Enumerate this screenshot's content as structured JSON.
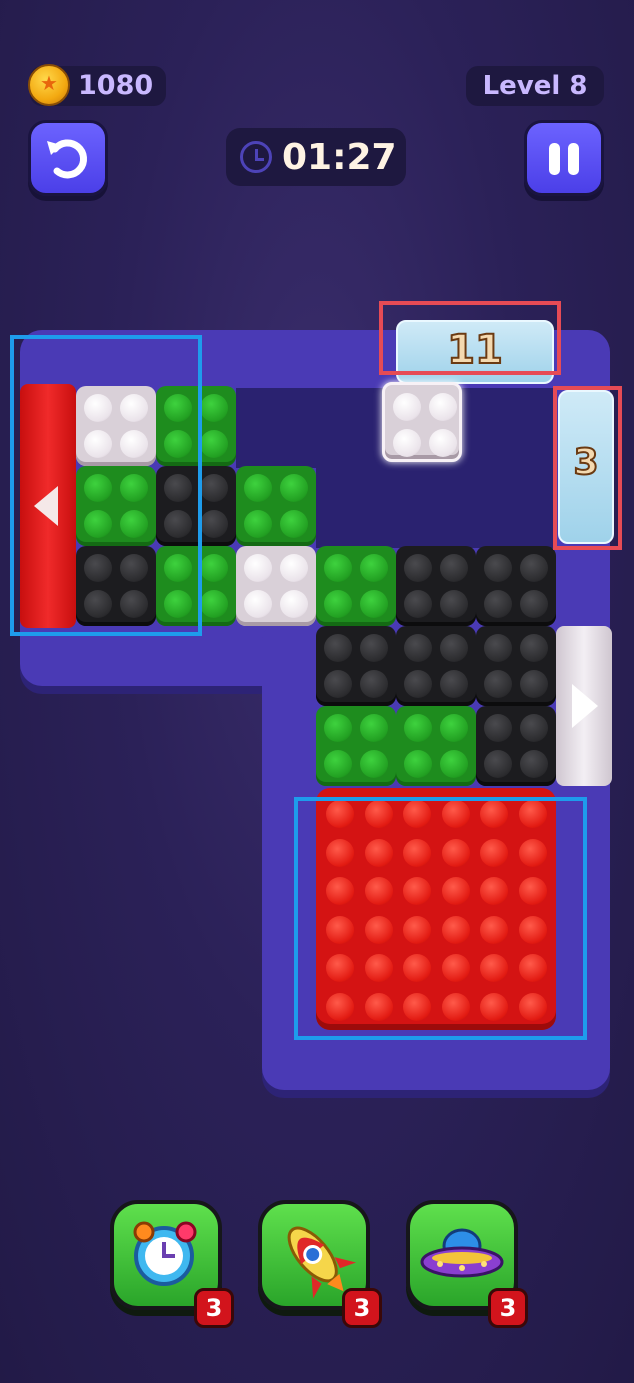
{
  "hud": {
    "coins": "1080",
    "level": "Level 8",
    "timer": "01:27"
  },
  "board": {
    "ice_gate_top": "11",
    "ice_gate_right": "3"
  },
  "boosters": [
    {
      "name": "alarm-clock-booster",
      "count": "3"
    },
    {
      "name": "rocket-booster",
      "count": "3"
    },
    {
      "name": "ufo-booster",
      "count": "3"
    }
  ],
  "colors": {
    "green": "#1e8c1e",
    "black": "#1c1c1f",
    "white": "#d9d0d8",
    "red": "#d41313",
    "board": "#4a3ab5"
  }
}
